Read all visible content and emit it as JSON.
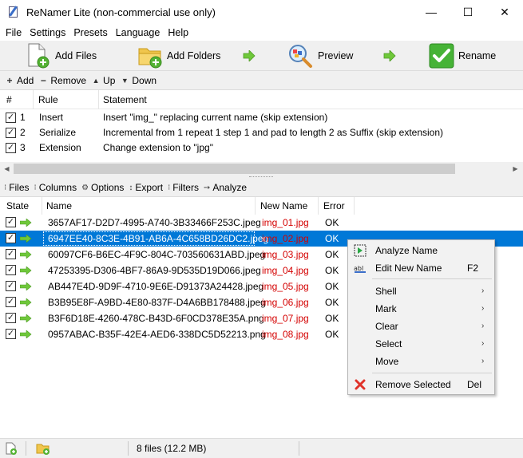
{
  "window": {
    "title": "ReNamer Lite (non-commercial use only)",
    "minimize": "—",
    "maximize": "☐",
    "close": "✕"
  },
  "menu": [
    "File",
    "Settings",
    "Presets",
    "Language",
    "Help"
  ],
  "toolbar": {
    "add_files": "Add Files",
    "add_folders": "Add Folders",
    "preview": "Preview",
    "rename": "Rename"
  },
  "rule_toolbar": {
    "add": "Add",
    "remove": "Remove",
    "up": "Up",
    "down": "Down",
    "add_icon": "+",
    "remove_icon": "−",
    "up_icon": "▲",
    "down_icon": "▼"
  },
  "rules_table": {
    "headers": [
      "#",
      "Rule",
      "Statement"
    ],
    "rows": [
      {
        "num": "1",
        "rule": "Insert",
        "statement": "Insert \"img_\" replacing current name (skip extension)",
        "checked": true
      },
      {
        "num": "2",
        "rule": "Serialize",
        "statement": "Incremental from 1 repeat 1 step 1 and pad to length 2 as Suffix (skip extension)",
        "checked": true
      },
      {
        "num": "3",
        "rule": "Extension",
        "statement": "Change extension to \"jpg\"",
        "checked": true
      }
    ]
  },
  "files_toolbar": {
    "files": "Files",
    "columns": "Columns",
    "options": "Options",
    "export": "Export",
    "filters": "Filters",
    "analyze": "Analyze"
  },
  "files_table": {
    "headers": [
      "State",
      "Name",
      "New Name",
      "Error"
    ],
    "rows": [
      {
        "name": "3657AF17-D2D7-4995-A740-3B33466F253C.jpeg",
        "new_name": "img_01.jpg",
        "error": "OK",
        "checked": true,
        "selected": false
      },
      {
        "name": "6947EE40-8C3E-4B91-AB6A-4C658BD26DC2.jpeg",
        "new_name": "img_02.jpg",
        "error": "OK",
        "checked": true,
        "selected": true
      },
      {
        "name": "60097CF6-B6EC-4F9C-804C-703560631ABD.jpeg",
        "new_name": "img_03.jpg",
        "error": "OK",
        "checked": true,
        "selected": false
      },
      {
        "name": "47253395-D306-4BF7-86A9-9D535D19D066.jpeg",
        "new_name": "img_04.jpg",
        "error": "OK",
        "checked": true,
        "selected": false
      },
      {
        "name": "AB447E4D-9D9F-4710-9E6E-D91373A24428.jpeg",
        "new_name": "img_05.jpg",
        "error": "OK",
        "checked": true,
        "selected": false
      },
      {
        "name": "B3B95E8F-A9BD-4E80-837F-D4A6BB178488.jpeg",
        "new_name": "img_06.jpg",
        "error": "OK",
        "checked": true,
        "selected": false
      },
      {
        "name": "B3F6D18E-4260-478C-B43D-6F0CD378E35A.png",
        "new_name": "img_07.jpg",
        "error": "OK",
        "checked": true,
        "selected": false
      },
      {
        "name": "0957ABAC-B35F-42E4-AED6-338DC5D52213.png",
        "new_name": "img_08.jpg",
        "error": "OK",
        "checked": true,
        "selected": false
      }
    ]
  },
  "context_menu": {
    "items": [
      {
        "label": "Analyze Name",
        "shortcut": "",
        "submenu": false
      },
      {
        "label": "Edit New Name",
        "shortcut": "F2",
        "submenu": false
      },
      {
        "label": "Shell",
        "shortcut": "",
        "submenu": true
      },
      {
        "label": "Mark",
        "shortcut": "",
        "submenu": true
      },
      {
        "label": "Clear",
        "shortcut": "",
        "submenu": true
      },
      {
        "label": "Select",
        "shortcut": "",
        "submenu": true
      },
      {
        "label": "Move",
        "shortcut": "",
        "submenu": true
      },
      {
        "label": "Remove Selected",
        "shortcut": "Del",
        "submenu": false
      }
    ],
    "submenu_glyph": "›"
  },
  "status": {
    "text": "8 files (12.2 MB)"
  },
  "colors": {
    "selection": "#0078d7",
    "new_name": "#d40000",
    "arrow_green": "#6fc83a"
  }
}
